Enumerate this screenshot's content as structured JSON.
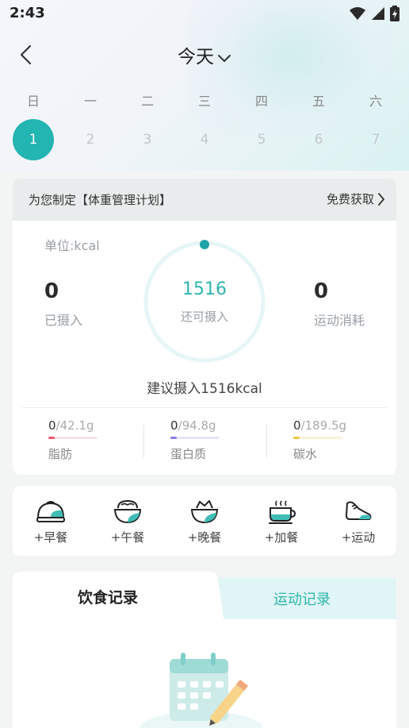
{
  "status": {
    "time": "2:43"
  },
  "nav": {
    "title": "今天"
  },
  "week": {
    "weekdays": [
      "日",
      "一",
      "二",
      "三",
      "四",
      "五",
      "六"
    ],
    "days": [
      "1",
      "2",
      "3",
      "4",
      "5",
      "6",
      "7"
    ],
    "active_index": 0
  },
  "plan": {
    "banner_text": "为您制定【体重管理计划】",
    "link_text": "免费获取",
    "unit": "单位:kcal",
    "intake_value": "0",
    "intake_label": "已摄入",
    "remaining_value": "1516",
    "remaining_label": "还可摄入",
    "burn_value": "0",
    "burn_label": "运动消耗",
    "suggest": "建议摄入1516kcal",
    "macros": [
      {
        "current": "0",
        "target": "/42.1g",
        "label": "脂肪",
        "color": "#f0576b",
        "track": "#fbe3e6"
      },
      {
        "current": "0",
        "target": "/94.8g",
        "label": "蛋白质",
        "color": "#8a7ef0",
        "track": "#e6e3fb"
      },
      {
        "current": "0",
        "target": "/189.5g",
        "label": "碳水",
        "color": "#f2c53d",
        "track": "#fbf1d6"
      }
    ]
  },
  "meals": [
    {
      "label": "+早餐",
      "icon": "breakfast-bun-icon"
    },
    {
      "label": "+午餐",
      "icon": "lunch-bowl-icon"
    },
    {
      "label": "+晚餐",
      "icon": "dinner-bowl-icon"
    },
    {
      "label": "+加餐",
      "icon": "snack-cup-icon"
    },
    {
      "label": "+运动",
      "icon": "sneaker-icon"
    }
  ],
  "records": {
    "tab_diet": "饮食记录",
    "tab_exercise": "运动记录"
  },
  "colors": {
    "accent": "#22b5b2",
    "text": "#333333"
  }
}
